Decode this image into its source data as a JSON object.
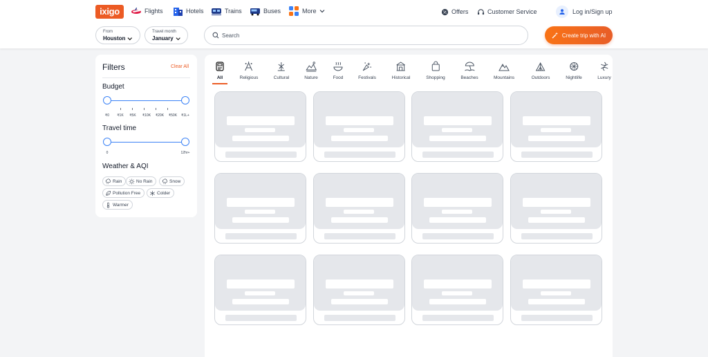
{
  "header": {
    "logo": "ixigo",
    "nav": [
      {
        "label": "Flights",
        "icon": "flight-icon"
      },
      {
        "label": "Hotels",
        "icon": "hotel-icon"
      },
      {
        "label": "Trains",
        "icon": "train-icon"
      },
      {
        "label": "Buses",
        "icon": "bus-icon"
      },
      {
        "label": "More",
        "icon": "apps-grid-icon"
      }
    ],
    "offers": "Offers",
    "customer_service": "Customer Service",
    "login": "Log in/Sign up"
  },
  "trip_bar": {
    "from_label": "From",
    "from_value": "Houston",
    "month_label": "Travel month",
    "month_value": "January",
    "search_placeholder": "Search",
    "ai_button": "Create trip with AI"
  },
  "filters": {
    "title": "Filters",
    "clear": "Clear All",
    "budget": {
      "title": "Budget",
      "ticks": [
        "₹0",
        "₹1K",
        "₹5K",
        "₹10K",
        "₹20K",
        "₹50K",
        "₹1L+"
      ]
    },
    "travel_time": {
      "title": "Travel time",
      "min": "0",
      "max": "12hr+"
    },
    "weather": {
      "title": "Weather & AQI",
      "chips": [
        {
          "label": "Rain",
          "icon": "rain-cloud-icon"
        },
        {
          "label": "No Rain",
          "icon": "sun-icon"
        },
        {
          "label": "Snow",
          "icon": "snow-cloud-icon"
        },
        {
          "label": "Pollution Free",
          "icon": "leaf-icon"
        },
        {
          "label": "Colder",
          "icon": "snowflake-icon"
        },
        {
          "label": "Warmer",
          "icon": "thermometer-icon"
        }
      ]
    }
  },
  "categories": [
    {
      "label": "All",
      "icon": "all-icon",
      "active": true
    },
    {
      "label": "Religious",
      "icon": "religious-icon"
    },
    {
      "label": "Cultural",
      "icon": "cultural-icon"
    },
    {
      "label": "Nature",
      "icon": "nature-icon"
    },
    {
      "label": "Food",
      "icon": "food-icon"
    },
    {
      "label": "Festivals",
      "icon": "festivals-icon"
    },
    {
      "label": "Historical",
      "icon": "historical-icon"
    },
    {
      "label": "Shopping",
      "icon": "shopping-icon"
    },
    {
      "label": "Beaches",
      "icon": "beach-icon"
    },
    {
      "label": "Mountains",
      "icon": "mountain-icon"
    },
    {
      "label": "Outdoors",
      "icon": "outdoors-icon"
    },
    {
      "label": "Nightlife",
      "icon": "nightlife-icon"
    },
    {
      "label": "Luxury",
      "icon": "luxury-icon"
    }
  ],
  "colors": {
    "brand": "#ec5b24",
    "accent": "#3b82f6",
    "placeholder": "#e5e7eb"
  }
}
